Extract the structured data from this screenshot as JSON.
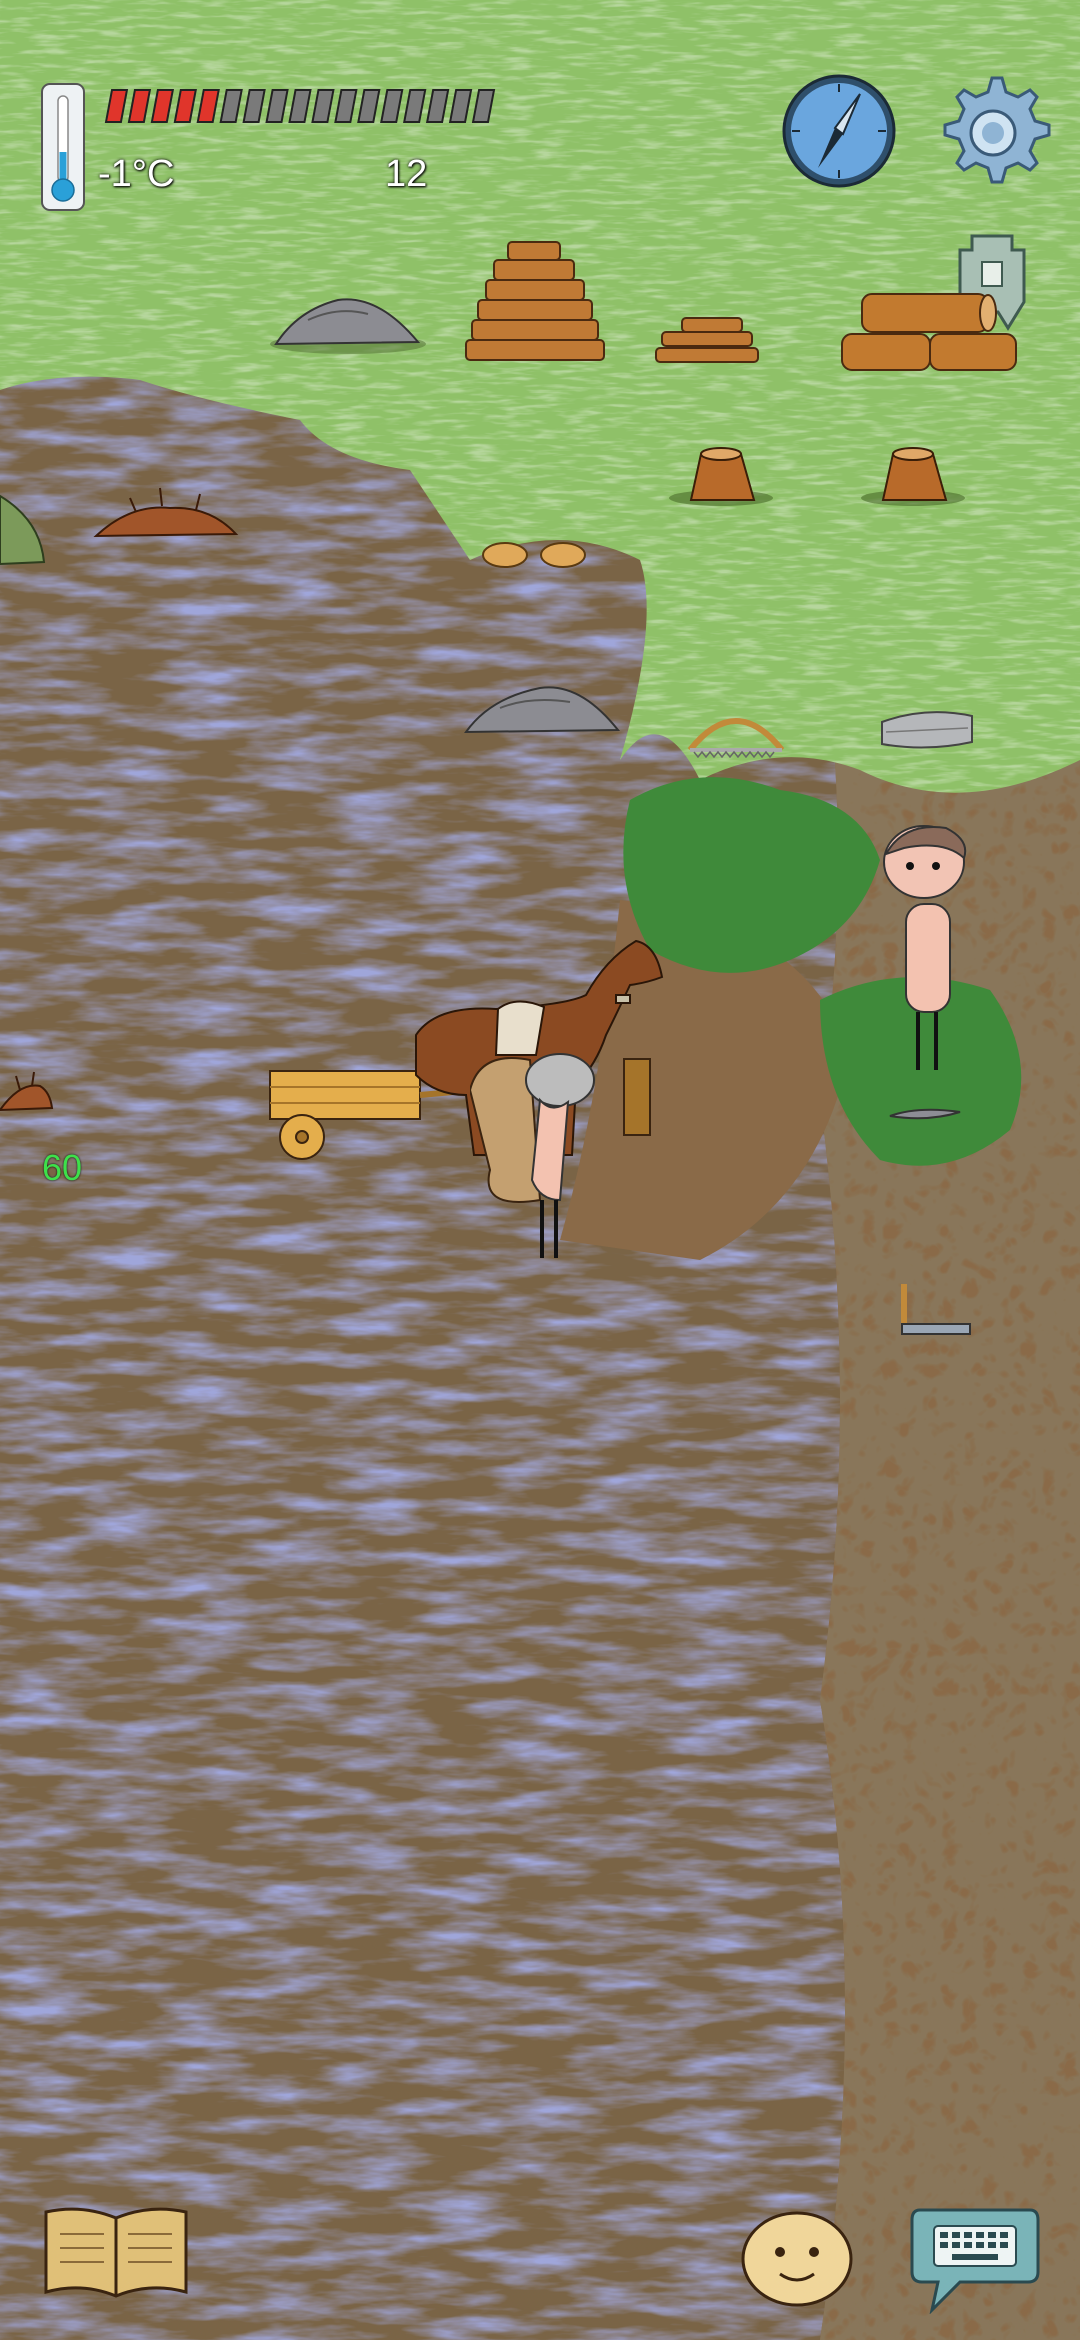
{
  "hud": {
    "temperature": "-1°C",
    "age": "12",
    "food_pips_filled": 5,
    "food_pips_total": 17,
    "fps": "60",
    "icons": [
      "thermometer-icon",
      "compass-icon",
      "settings-gear-icon",
      "ancient-coin-icon",
      "journal-book-icon",
      "emote-face-icon",
      "chat-keyboard-icon"
    ]
  },
  "world": {
    "objects": [
      "stone-pile",
      "firewood-stack",
      "kindling-pile",
      "log-pile",
      "tree-stump",
      "tree-stump",
      "flat-rocks",
      "stone-pile-2",
      "bow-saw",
      "flat-stone-slab",
      "dug-burrow",
      "dug-burrow-2",
      "horse-cart",
      "elder-player",
      "child-player",
      "sharp-stone",
      "shovel",
      "bush"
    ]
  },
  "colors": {
    "grass": "#8fc168",
    "swamp": "#6e5e45",
    "food_fill": "#e0352b",
    "food_empty": "#7a7a7a",
    "fps_text": "#3ee04a"
  }
}
